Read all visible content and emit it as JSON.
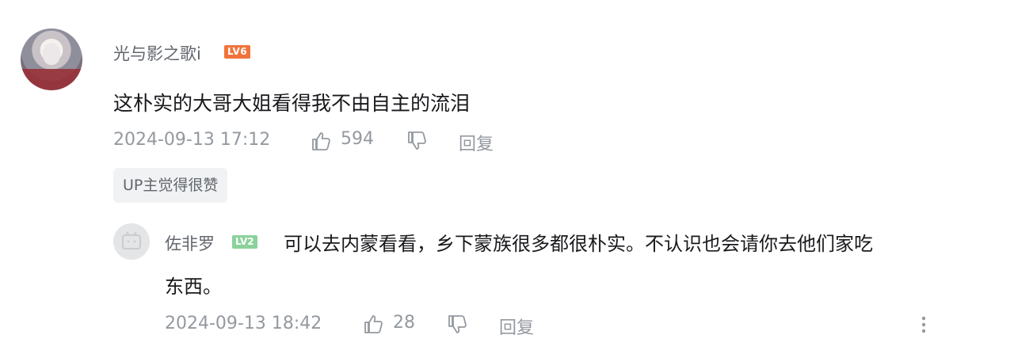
{
  "comment": {
    "username": "光与影之歌i",
    "level": "LV6",
    "text": "这朴实的大哥大姐看得我不由自主的流泪",
    "timestamp": "2024-09-13 17:12",
    "like_count": "594",
    "reply_label": "回复",
    "tag": "UP主觉得很赞"
  },
  "reply": {
    "username": "佐非罗",
    "level": "LV2",
    "text_line1": "可以去内蒙看看，乡下蒙族很多都很朴实。不认识也会请你去他们家吃",
    "text_line2": "东西。",
    "timestamp": "2024-09-13 18:42",
    "like_count": "28",
    "reply_label": "回复"
  },
  "icons": {
    "like": "thumbs-up-icon",
    "dislike": "thumbs-down-icon",
    "more": "more-vertical-icon"
  },
  "colors": {
    "lv6_badge": "#f0733b",
    "lv2_badge": "#8bd29b",
    "meta_text": "#9499a0",
    "username": "#61666d"
  }
}
